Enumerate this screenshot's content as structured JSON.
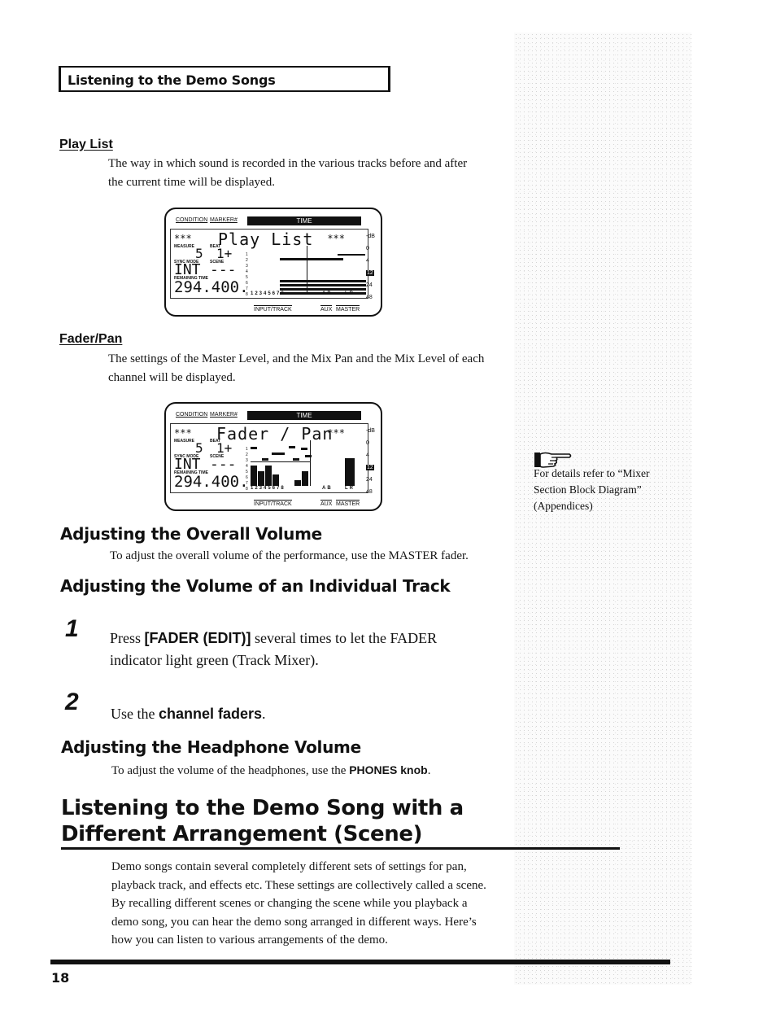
{
  "page": {
    "section_header": "Listening to the Demo Songs",
    "page_number": "18"
  },
  "play_list": {
    "heading": "Play List",
    "text_line1": "The way in which sound is recorded in the various tracks before and after",
    "text_line2": "the current time will be displayed.",
    "display": {
      "condition_label": "CONDITION",
      "marker_label": "MARKER#",
      "time_label": "TIME",
      "title": "Play List",
      "stars": "***",
      "measure_label": "MEASURE",
      "beat_label": "BEAT",
      "measure_value": "5",
      "beat_value": "1+",
      "sync_mode_label": "SYNC MODE",
      "scene_label": "SCENE",
      "sync_mode_value": "INT",
      "scene_value": "---",
      "remaining_time_label": "REMAINING TIME",
      "remaining_time_value": "294.400.",
      "row_numbers": [
        "1",
        "2",
        "3",
        "4",
        "5",
        "6",
        "7",
        "8"
      ],
      "track_numbers": "12345678",
      "ab_label": "AB",
      "lr_label": "LR",
      "input_track_label": "INPUT/TRACK",
      "aux_label": "AUX",
      "master_label": "MASTER",
      "db_scale": [
        "-dB",
        "0",
        "4",
        "12",
        "24",
        "48"
      ]
    }
  },
  "fader_pan": {
    "heading": "Fader/Pan",
    "text_line1": "The settings of the Master Level, and the Mix Pan and the Mix Level of each",
    "text_line2": "channel will be displayed.",
    "display": {
      "condition_label": "CONDITION",
      "marker_label": "MARKER#",
      "time_label": "TIME",
      "title": "Fader / Pan",
      "stars": "***",
      "measure_label": "MEASURE",
      "beat_label": "BEAT",
      "measure_value": "5",
      "beat_value": "1+",
      "sync_mode_label": "SYNC MODE",
      "scene_label": "SCENE",
      "sync_mode_value": "INT",
      "scene_value": "---",
      "remaining_time_label": "REMAINING TIME",
      "remaining_time_value": "294.400.",
      "row_numbers": [
        "1",
        "2",
        "3",
        "4",
        "5",
        "6",
        "7",
        "8"
      ],
      "track_numbers": "12345678",
      "ab_label": "AB",
      "lr_label": "LR",
      "input_track_label": "INPUT/TRACK",
      "aux_label": "AUX",
      "master_label": "MASTER",
      "db_scale": [
        "-dB",
        "0",
        "4",
        "12",
        "24",
        "48"
      ]
    }
  },
  "side_note": {
    "icon": "pointing-hand-icon",
    "text_line1": "For details refer to “Mixer",
    "text_line2": "Section Block Diagram”",
    "text_line3": "(Appendices)"
  },
  "overall_volume": {
    "heading": "Adjusting the Overall Volume",
    "text": "To adjust the overall volume of the performance, use the MASTER fader."
  },
  "individual_track": {
    "heading": "Adjusting the Volume of an Individual Track",
    "steps": [
      {
        "number": "1",
        "pre": "Press ",
        "bold": "[FADER (EDIT)]",
        "post": " several times to let the FADER",
        "line2": "indicator light green (Track Mixer)."
      },
      {
        "number": "2",
        "pre": "Use the ",
        "bold": "channel faders",
        "post": "."
      }
    ]
  },
  "headphone_volume": {
    "heading": "Adjusting the Headphone Volume",
    "text_pre": "To adjust the volume of the headphones, use the ",
    "text_bold": "PHONES knob",
    "text_post": "."
  },
  "scene_section": {
    "heading_line1": "Listening to the Demo Song with a",
    "heading_line2": "Different Arrangement (Scene)",
    "paragraph": [
      "Demo songs contain several completely different sets of settings for pan,",
      "playback track, and effects etc. These settings are collectively called a scene.",
      "By recalling different scenes or changing the scene while you playback a",
      "demo song, you can hear the demo song arranged in different ways. Here’s",
      "how you can listen to various arrangements of the demo."
    ]
  }
}
